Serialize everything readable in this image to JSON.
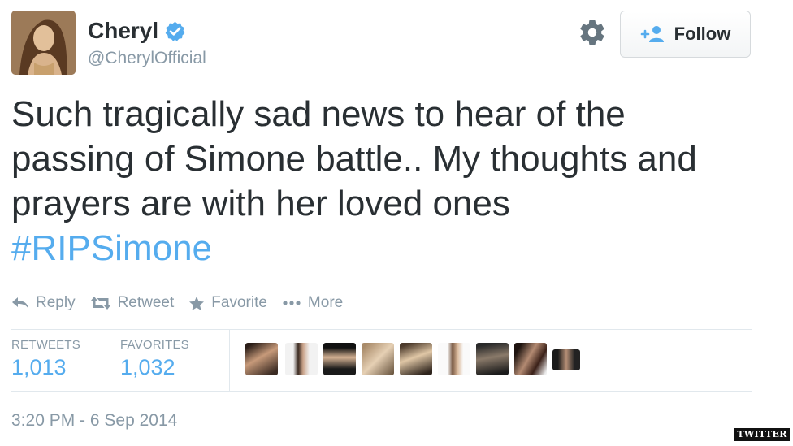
{
  "author": {
    "display_name": "Cheryl",
    "handle": "@CherylOfficial",
    "verified": true,
    "avatar_icon": "profile-photo"
  },
  "header": {
    "settings_icon": "gear-icon",
    "follow_label": "Follow",
    "follow_icon": "add-user-icon"
  },
  "tweet": {
    "text_lines": [
      "Such tragically sad news to hear of the",
      "passing of Simone battle.. My thoughts and",
      "prayers are with her loved ones"
    ],
    "hashtag": "#RIPSimone"
  },
  "actions": [
    {
      "label": "Reply",
      "icon": "reply-icon"
    },
    {
      "label": "Retweet",
      "icon": "retweet-icon"
    },
    {
      "label": "Favorite",
      "icon": "star-icon"
    },
    {
      "label": "More",
      "icon": "more-dots-icon"
    }
  ],
  "stats": {
    "retweets_label": "RETWEETS",
    "retweets_value": "1,013",
    "favorites_label": "FAVORITES",
    "favorites_value": "1,032"
  },
  "favorited_by_count_shown": 9,
  "timestamp": "3:20 PM - 6 Sep 2014",
  "watermark": "TWITTER",
  "colors": {
    "link_blue": "#55acee",
    "muted_gray": "#8899a6",
    "text_dark": "#292f33",
    "divider": "#e1e8ed"
  }
}
